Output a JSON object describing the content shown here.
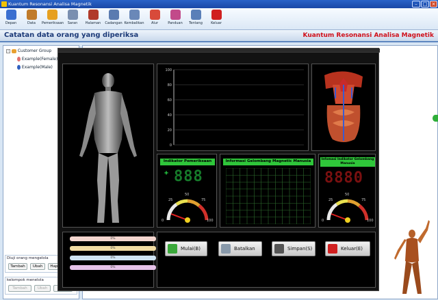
{
  "window": {
    "title": "Kuantum Resonansi Analisa Magnetik"
  },
  "toolbar": [
    {
      "label": "Depan",
      "icon": "home-icon",
      "color": "#3a6fd0"
    },
    {
      "label": "Data",
      "icon": "people-icon",
      "color": "#c07b2a"
    },
    {
      "label": "Pemeriksaan",
      "icon": "hand-icon",
      "color": "#e6a020"
    },
    {
      "label": "Saran",
      "icon": "document-icon",
      "color": "#7a8fb0"
    },
    {
      "label": "Halaman",
      "icon": "page-icon",
      "color": "#b03a2a"
    },
    {
      "label": "Cadangan",
      "icon": "backup-icon",
      "color": "#5a7bb0"
    },
    {
      "label": "Kembalikan",
      "icon": "restore-icon",
      "color": "#6a88b8"
    },
    {
      "label": "Alur",
      "icon": "flow-icon",
      "color": "#d84a3a"
    },
    {
      "label": "Panduan",
      "icon": "book-icon",
      "color": "#c24a8a"
    },
    {
      "label": "Tentang",
      "icon": "info-icon",
      "color": "#5a7fb8"
    },
    {
      "label": "Keluar",
      "icon": "exit-icon",
      "color": "#d02020"
    }
  ],
  "header": {
    "title": "Catatan data orang yang diperiksa",
    "brand": "Kuantum Resonansi Analisa Magnetik"
  },
  "tree": {
    "root": "Customer Group",
    "items": [
      "Example(Female)",
      "Example(Male)"
    ]
  },
  "left_groups": {
    "group1": {
      "title": "Diuji orang mengelola",
      "buttons": [
        "Tambah",
        "Ubah",
        "Hapus"
      ]
    },
    "group2": {
      "title": "kelompok menelola",
      "buttons": [
        "Tambah",
        "Ubah",
        "Hapus"
      ]
    }
  },
  "chart_data": {
    "type": "line",
    "title": "",
    "xlabel": "",
    "ylabel": "",
    "ylim": [
      0,
      100
    ],
    "yticks": [
      0,
      20,
      40,
      60,
      80,
      100
    ],
    "series": []
  },
  "indicator": {
    "title": "Indikator Pemeriksaan",
    "sign": "+",
    "digits": "888"
  },
  "wave": {
    "title": "Informasi Gelombang Magnetic Manusia"
  },
  "info_indicator": {
    "title": "Infomasi Indikator Gelombang Manusia",
    "digits": "8880"
  },
  "gauge": {
    "ticks": [
      "0",
      "25",
      "50",
      "75",
      "100"
    ],
    "value": 5
  },
  "progress": [
    "0%",
    "0%",
    "0%",
    "0%"
  ],
  "progress_colors": [
    "#f4d6cf",
    "#f2dba2",
    "#cfe4f4",
    "#e7c3ea"
  ],
  "actions": [
    {
      "label": "Mulai(B)",
      "icon": "start-icon",
      "color": "#3aa83a"
    },
    {
      "label": "Batalkan",
      "icon": "cancel-icon",
      "color": "#8899aa"
    },
    {
      "label": "Simpan(S)",
      "icon": "save-icon",
      "color": "#555"
    },
    {
      "label": "Keluar(E)",
      "icon": "exit-icon",
      "color": "#d02020"
    }
  ]
}
